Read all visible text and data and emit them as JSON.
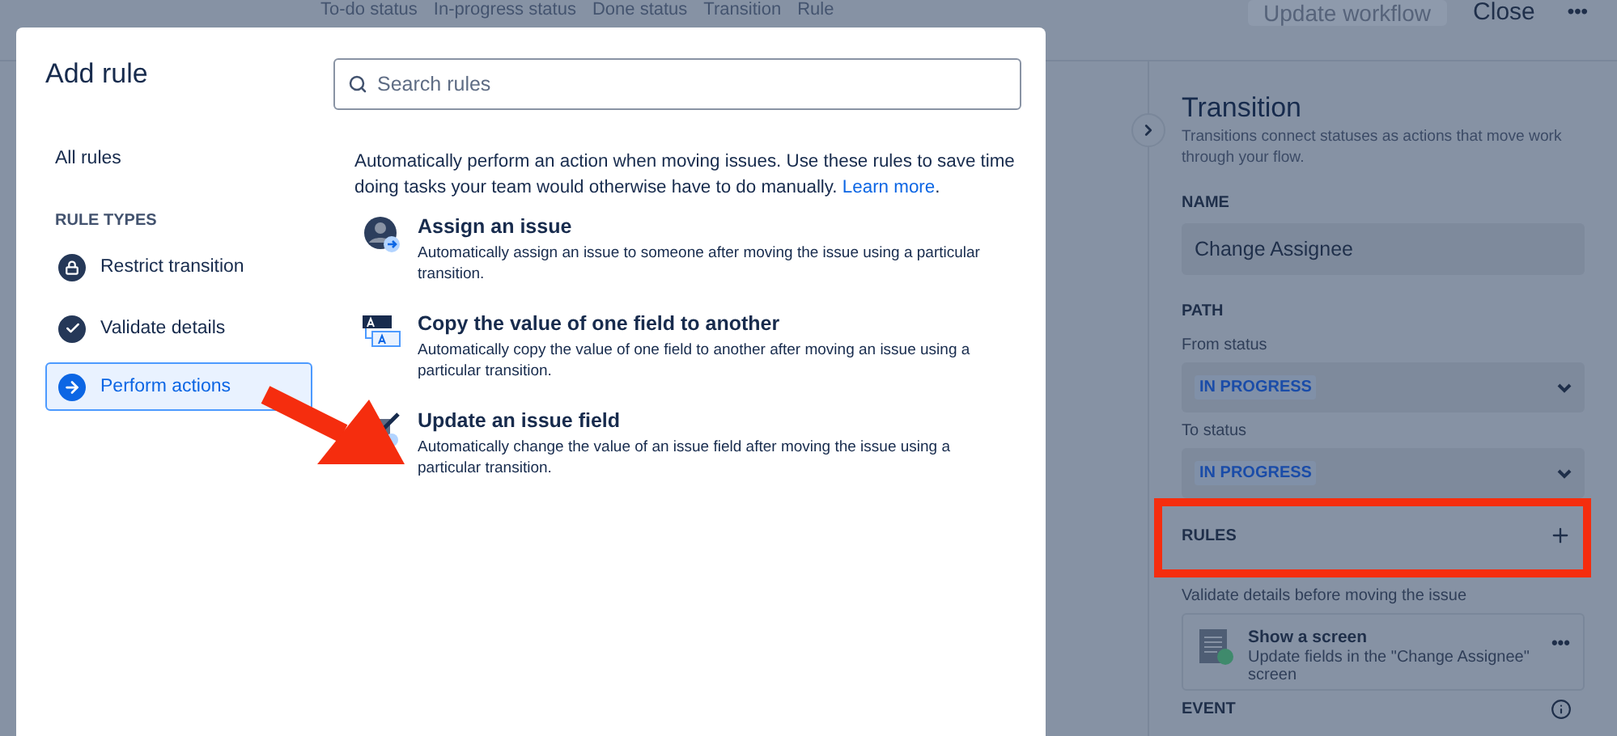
{
  "toolbar": {
    "items": [
      {
        "label": "To-do status"
      },
      {
        "label": "In-progress status"
      },
      {
        "label": "Done status"
      },
      {
        "label": "Transition"
      },
      {
        "label": "Rule"
      }
    ],
    "update_button": {
      "label": "Update workflow",
      "disabled": true
    },
    "close": "Close",
    "more": "•••"
  },
  "modal": {
    "title": "Add rule",
    "search": {
      "placeholder": "Search rules"
    },
    "all_rules": "All rules",
    "section_label": "RULE TYPES",
    "rule_types": [
      {
        "label": "Restrict transition",
        "kind": "lock",
        "selected": false
      },
      {
        "label": "Validate details",
        "kind": "check",
        "selected": false
      },
      {
        "label": "Perform actions",
        "kind": "arrow",
        "selected": true
      }
    ],
    "description": "Automatically perform an action when moving issues. Use these rules to save time doing tasks your team would otherwise have to do manually.",
    "link": "Learn more",
    "description_end": ".",
    "rules": [
      {
        "kind": "assign",
        "title": "Assign an issue",
        "description": "Automatically assign an issue to someone after moving the issue using a particular transition."
      },
      {
        "kind": "copy",
        "title": "Copy the value of one field to another",
        "description": "Automatically copy the value of one field to another after moving an issue using a particular transition."
      },
      {
        "kind": "update",
        "title": "Update an issue field",
        "description": "Automatically change the value of an issue field after moving the issue using a particular transition."
      }
    ]
  },
  "panel": {
    "title": "Transition",
    "description": "Transitions connect statuses as actions that move work through your flow.",
    "name_label": "NAME",
    "name_value": "Change Assignee",
    "path_label": "PATH",
    "from_label": "From status",
    "from_value": "IN PROGRESS",
    "to_label": "To status",
    "to_value": "IN PROGRESS",
    "rules_label": "RULES",
    "rules_subtitle": "Validate details before moving the issue",
    "rule_card": {
      "title": "Show a screen",
      "description": "Update fields in the \"Change Assignee\" screen",
      "more": "•••"
    },
    "event_label": "EVENT"
  }
}
